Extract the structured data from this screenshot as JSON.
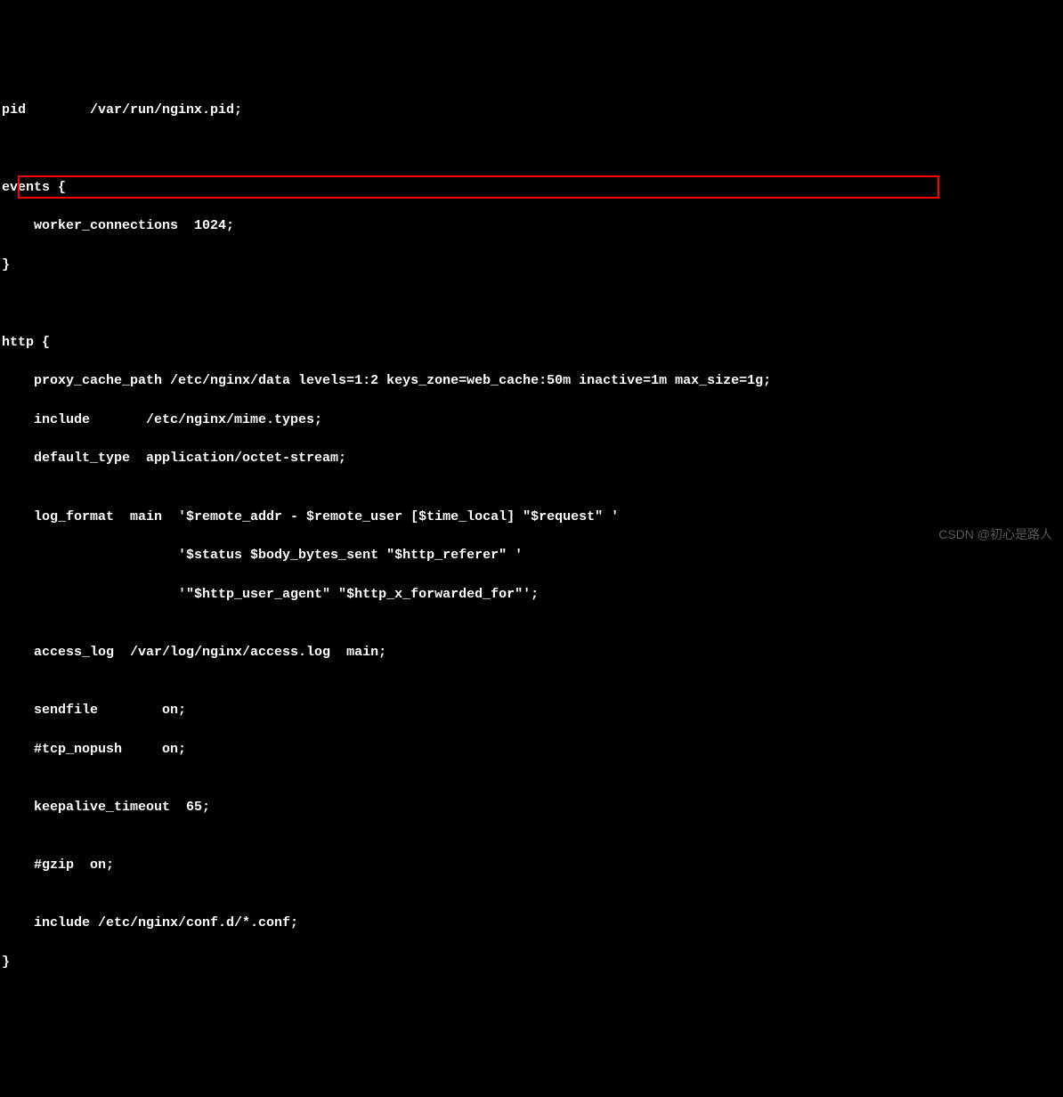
{
  "lines": {
    "l1": "pid        /var/run/nginx.pid;",
    "l2": "",
    "l3": "",
    "l4": "events {",
    "l5": "    worker_connections  1024;",
    "l6": "}",
    "l7": "",
    "l8": "",
    "l9": "http {",
    "l10": "    proxy_cache_path /etc/nginx/data levels=1:2 keys_zone=web_cache:50m inactive=1m max_size=1g;",
    "l11": "    include       /etc/nginx/mime.types;",
    "l12": "    default_type  application/octet-stream;",
    "l13": "",
    "l14": "    log_format  main  '$remote_addr - $remote_user [$time_local] \"$request\" '",
    "l15": "                      '$status $body_bytes_sent \"$http_referer\" '",
    "l16": "                      '\"$http_user_agent\" \"$http_x_forwarded_for\"';",
    "l17": "",
    "l18": "    access_log  /var/log/nginx/access.log  main;",
    "l19": "",
    "l20": "    sendfile        on;",
    "l21": "    #tcp_nopush     on;",
    "l22": "",
    "l23": "    keepalive_timeout  65;",
    "l24": "",
    "l25": "    #gzip  on;",
    "l26": "",
    "l27": "    include /etc/nginx/conf.d/*.conf;",
    "l28": "}"
  },
  "watermark": "CSDN @初心是路人"
}
